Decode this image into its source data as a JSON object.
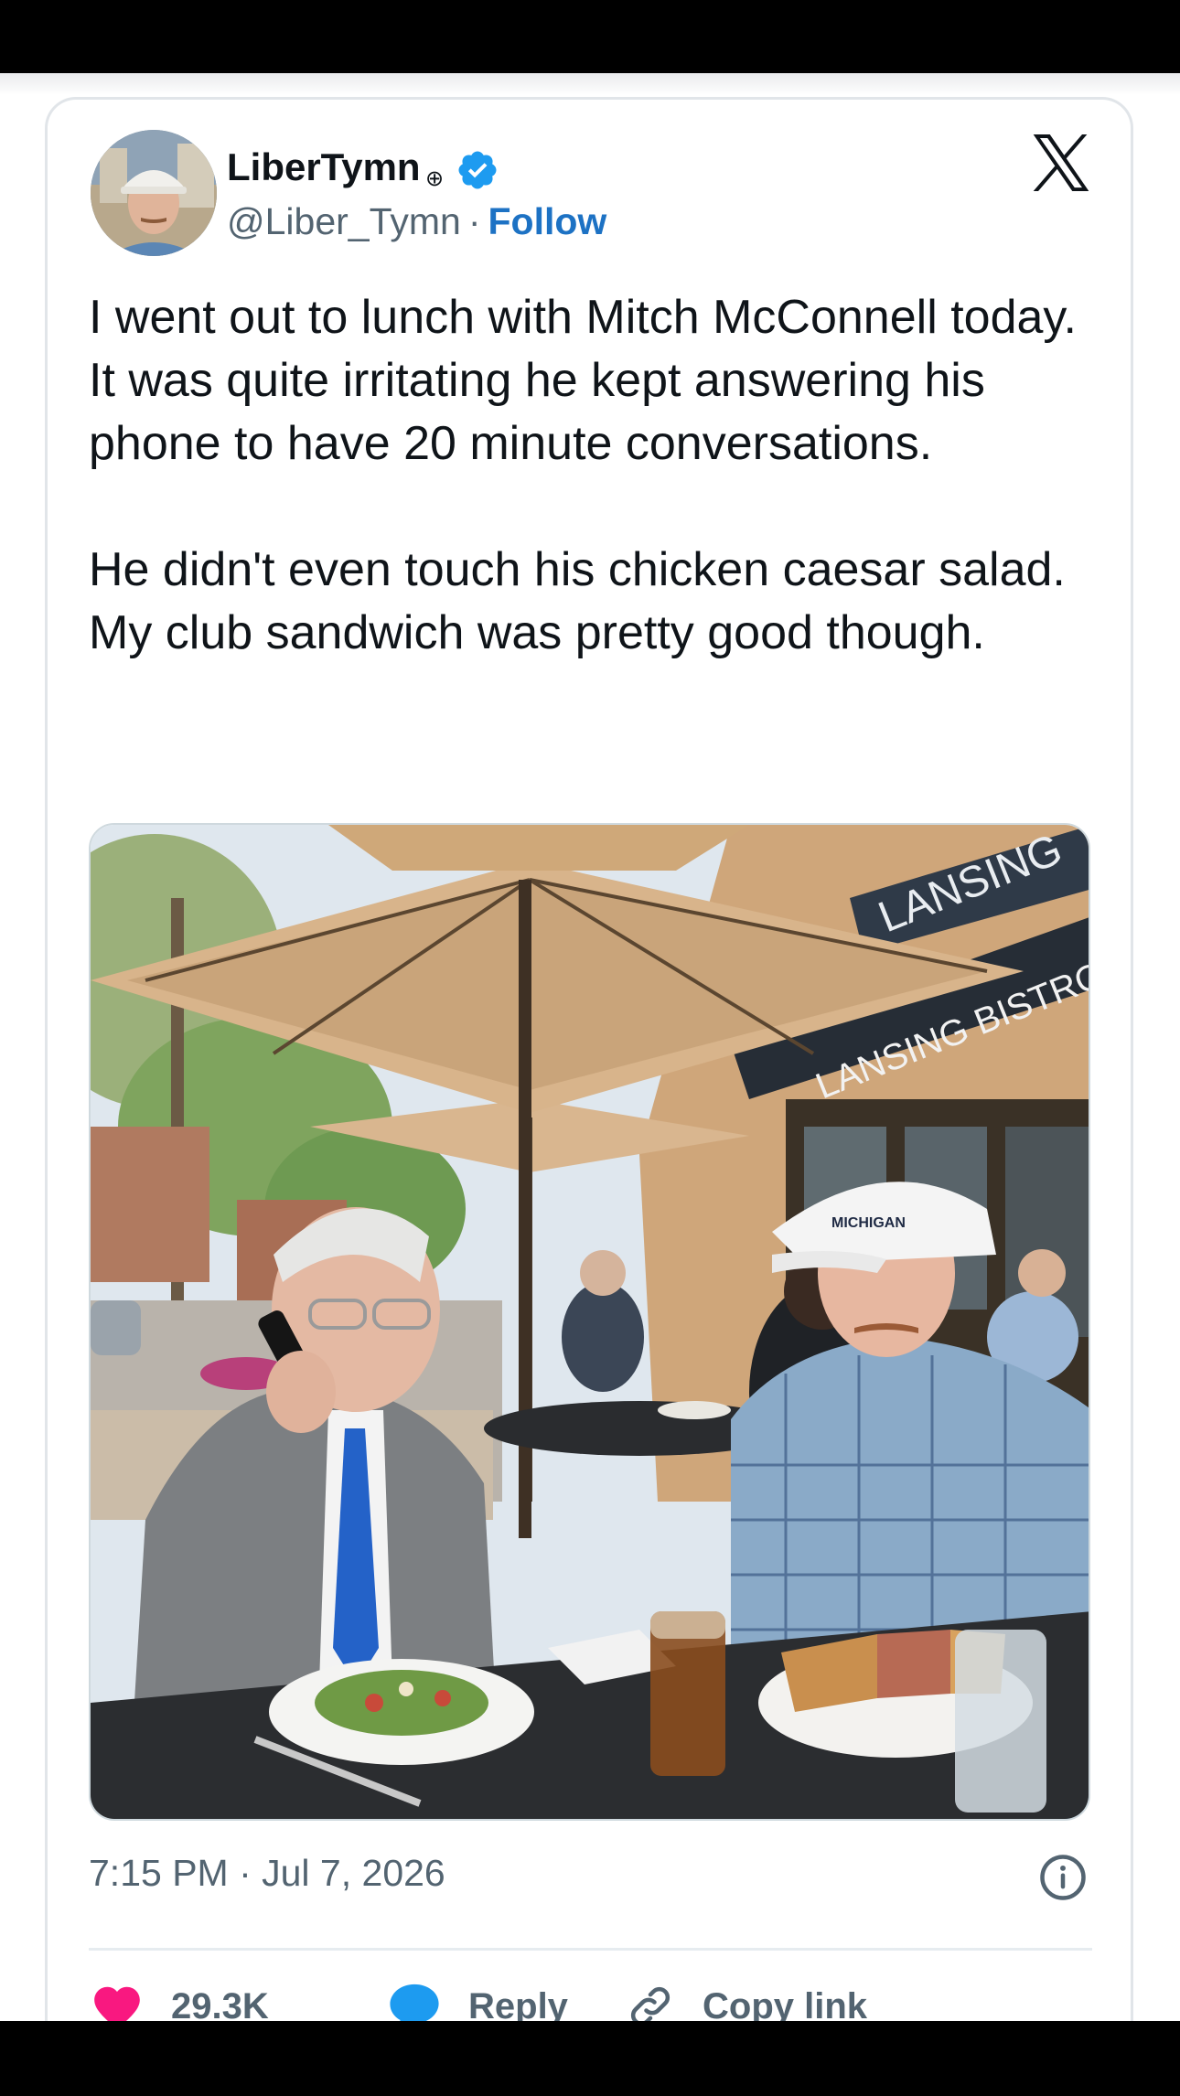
{
  "author": {
    "display_name": "LiberTymn",
    "name_glyph": "⊕",
    "handle": "@Liber_Tymn",
    "separator": "·",
    "follow_label": "Follow"
  },
  "tweet": {
    "paragraph_1": "I went out to lunch with Mitch McConnell today. It was quite irritating he kept answering his phone to have 20 minute conversations.",
    "paragraph_2": "He didn't even touch his chicken caesar salad. My club sandwich was pretty good though.",
    "timestamp": "7:15 PM · Jul 7, 2026"
  },
  "photo": {
    "sign_upper": "LANSING",
    "sign_lower": "LANSING BISTRO",
    "cap_logo": "MICHIGAN"
  },
  "actions": {
    "like_count": "29.3K",
    "reply_label": "Reply",
    "copy_label": "Copy link"
  },
  "colors": {
    "follow_blue": "#1d72c4",
    "verified_blue": "#1d9bf0",
    "like_pink": "#f91880",
    "reply_blue": "#1d9bf0"
  },
  "icons": [
    "verified-badge-icon",
    "x-logo-icon",
    "info-icon",
    "heart-icon",
    "reply-bubble-icon",
    "link-icon"
  ]
}
